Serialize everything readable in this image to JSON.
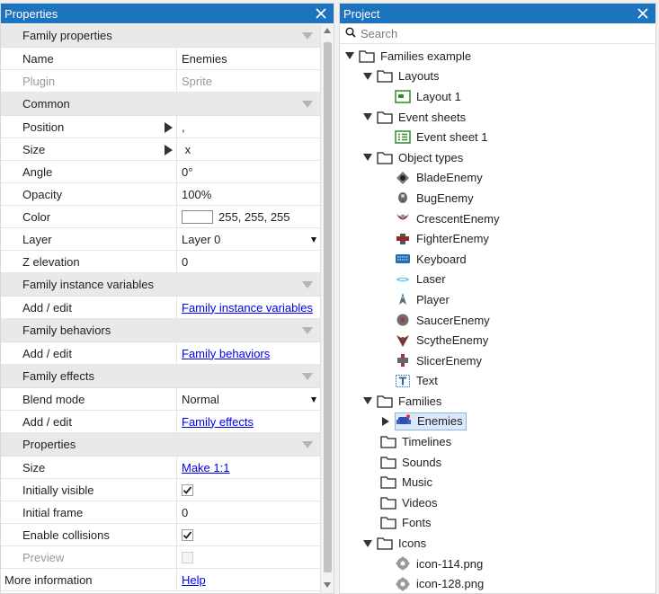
{
  "properties_panel": {
    "title": "Properties",
    "sections": {
      "family_properties": "Family properties",
      "common": "Common",
      "family_instance_variables": "Family instance variables",
      "family_behaviors": "Family behaviors",
      "family_effects": "Family effects",
      "properties": "Properties"
    },
    "rows": {
      "name": {
        "label": "Name",
        "value": "Enemies"
      },
      "plugin": {
        "label": "Plugin",
        "value": "Sprite"
      },
      "position": {
        "label": "Position",
        "value": ","
      },
      "size": {
        "label": "Size",
        "value": " x"
      },
      "angle": {
        "label": "Angle",
        "value": "0°"
      },
      "opacity": {
        "label": "Opacity",
        "value": "100%"
      },
      "color": {
        "label": "Color",
        "value": "255, 255, 255",
        "swatch": "#ffffff"
      },
      "layer": {
        "label": "Layer",
        "value": "Layer 0"
      },
      "z_elevation": {
        "label": "Z elevation",
        "value": "0"
      },
      "instance_vars": {
        "label": "Add / edit",
        "value": "Family instance variables"
      },
      "behaviors": {
        "label": "Add / edit",
        "value": "Family behaviors"
      },
      "blend_mode": {
        "label": "Blend mode",
        "value": "Normal"
      },
      "effects": {
        "label": "Add / edit",
        "value": "Family effects"
      },
      "prop_size": {
        "label": "Size",
        "value": "Make 1:1"
      },
      "initially_visible": {
        "label": "Initially visible",
        "checked": true
      },
      "initial_frame": {
        "label": "Initial frame",
        "value": "0"
      },
      "enable_collisions": {
        "label": "Enable collisions",
        "checked": true
      },
      "preview": {
        "label": "Preview",
        "checked": false
      },
      "more_info": {
        "label": "More information",
        "value": "Help"
      }
    }
  },
  "project_panel": {
    "title": "Project",
    "search": {
      "placeholder": "Search"
    },
    "tree": {
      "root": "Families example",
      "layouts": "Layouts",
      "layout_1": "Layout 1",
      "event_sheets": "Event sheets",
      "event_sheet_1": "Event sheet 1",
      "object_types": "Object types",
      "objects": [
        "BladeEnemy",
        "BugEnemy",
        "CrescentEnemy",
        "FighterEnemy",
        "Keyboard",
        "Laser",
        "Player",
        "SaucerEnemy",
        "ScytheEnemy",
        "SlicerEnemy",
        "Text"
      ],
      "families": "Families",
      "enemies": "Enemies",
      "timelines": "Timelines",
      "sounds": "Sounds",
      "music": "Music",
      "videos": "Videos",
      "fonts": "Fonts",
      "icons": "Icons",
      "icon_files": [
        "icon-114.png",
        "icon-128.png"
      ]
    }
  },
  "colors": {
    "titlebar": "#1e73be",
    "selection": "#dbe8fb",
    "link": "#0000ee"
  }
}
